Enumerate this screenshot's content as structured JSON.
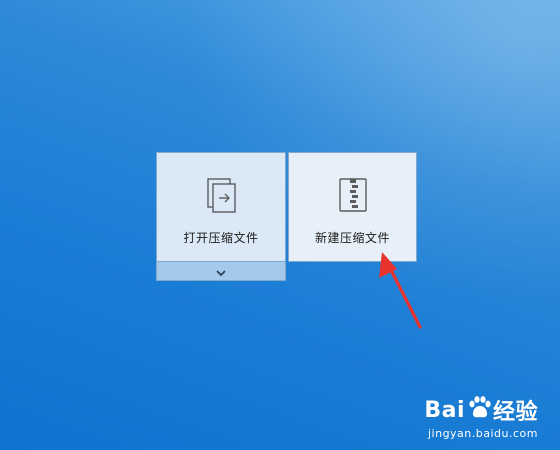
{
  "tiles": {
    "open": {
      "label": "打开压缩文件",
      "icon": "open-archive-icon"
    },
    "new": {
      "label": "新建压缩文件",
      "icon": "new-archive-icon"
    }
  },
  "expand": {
    "icon": "chevron-down-icon"
  },
  "annotation": {
    "icon": "red-arrow-icon",
    "color": "#e8322d"
  },
  "watermark": {
    "brand_left": "Bai",
    "brand_right": "经验",
    "url": "jingyan.baidu.com",
    "icon": "paw-icon"
  },
  "colors": {
    "desktop": "#1d7fd6",
    "tile_open_bg": "#dbe9f6",
    "tile_new_bg": "#e7f0f8",
    "expand_bg": "#a5c9ea"
  }
}
